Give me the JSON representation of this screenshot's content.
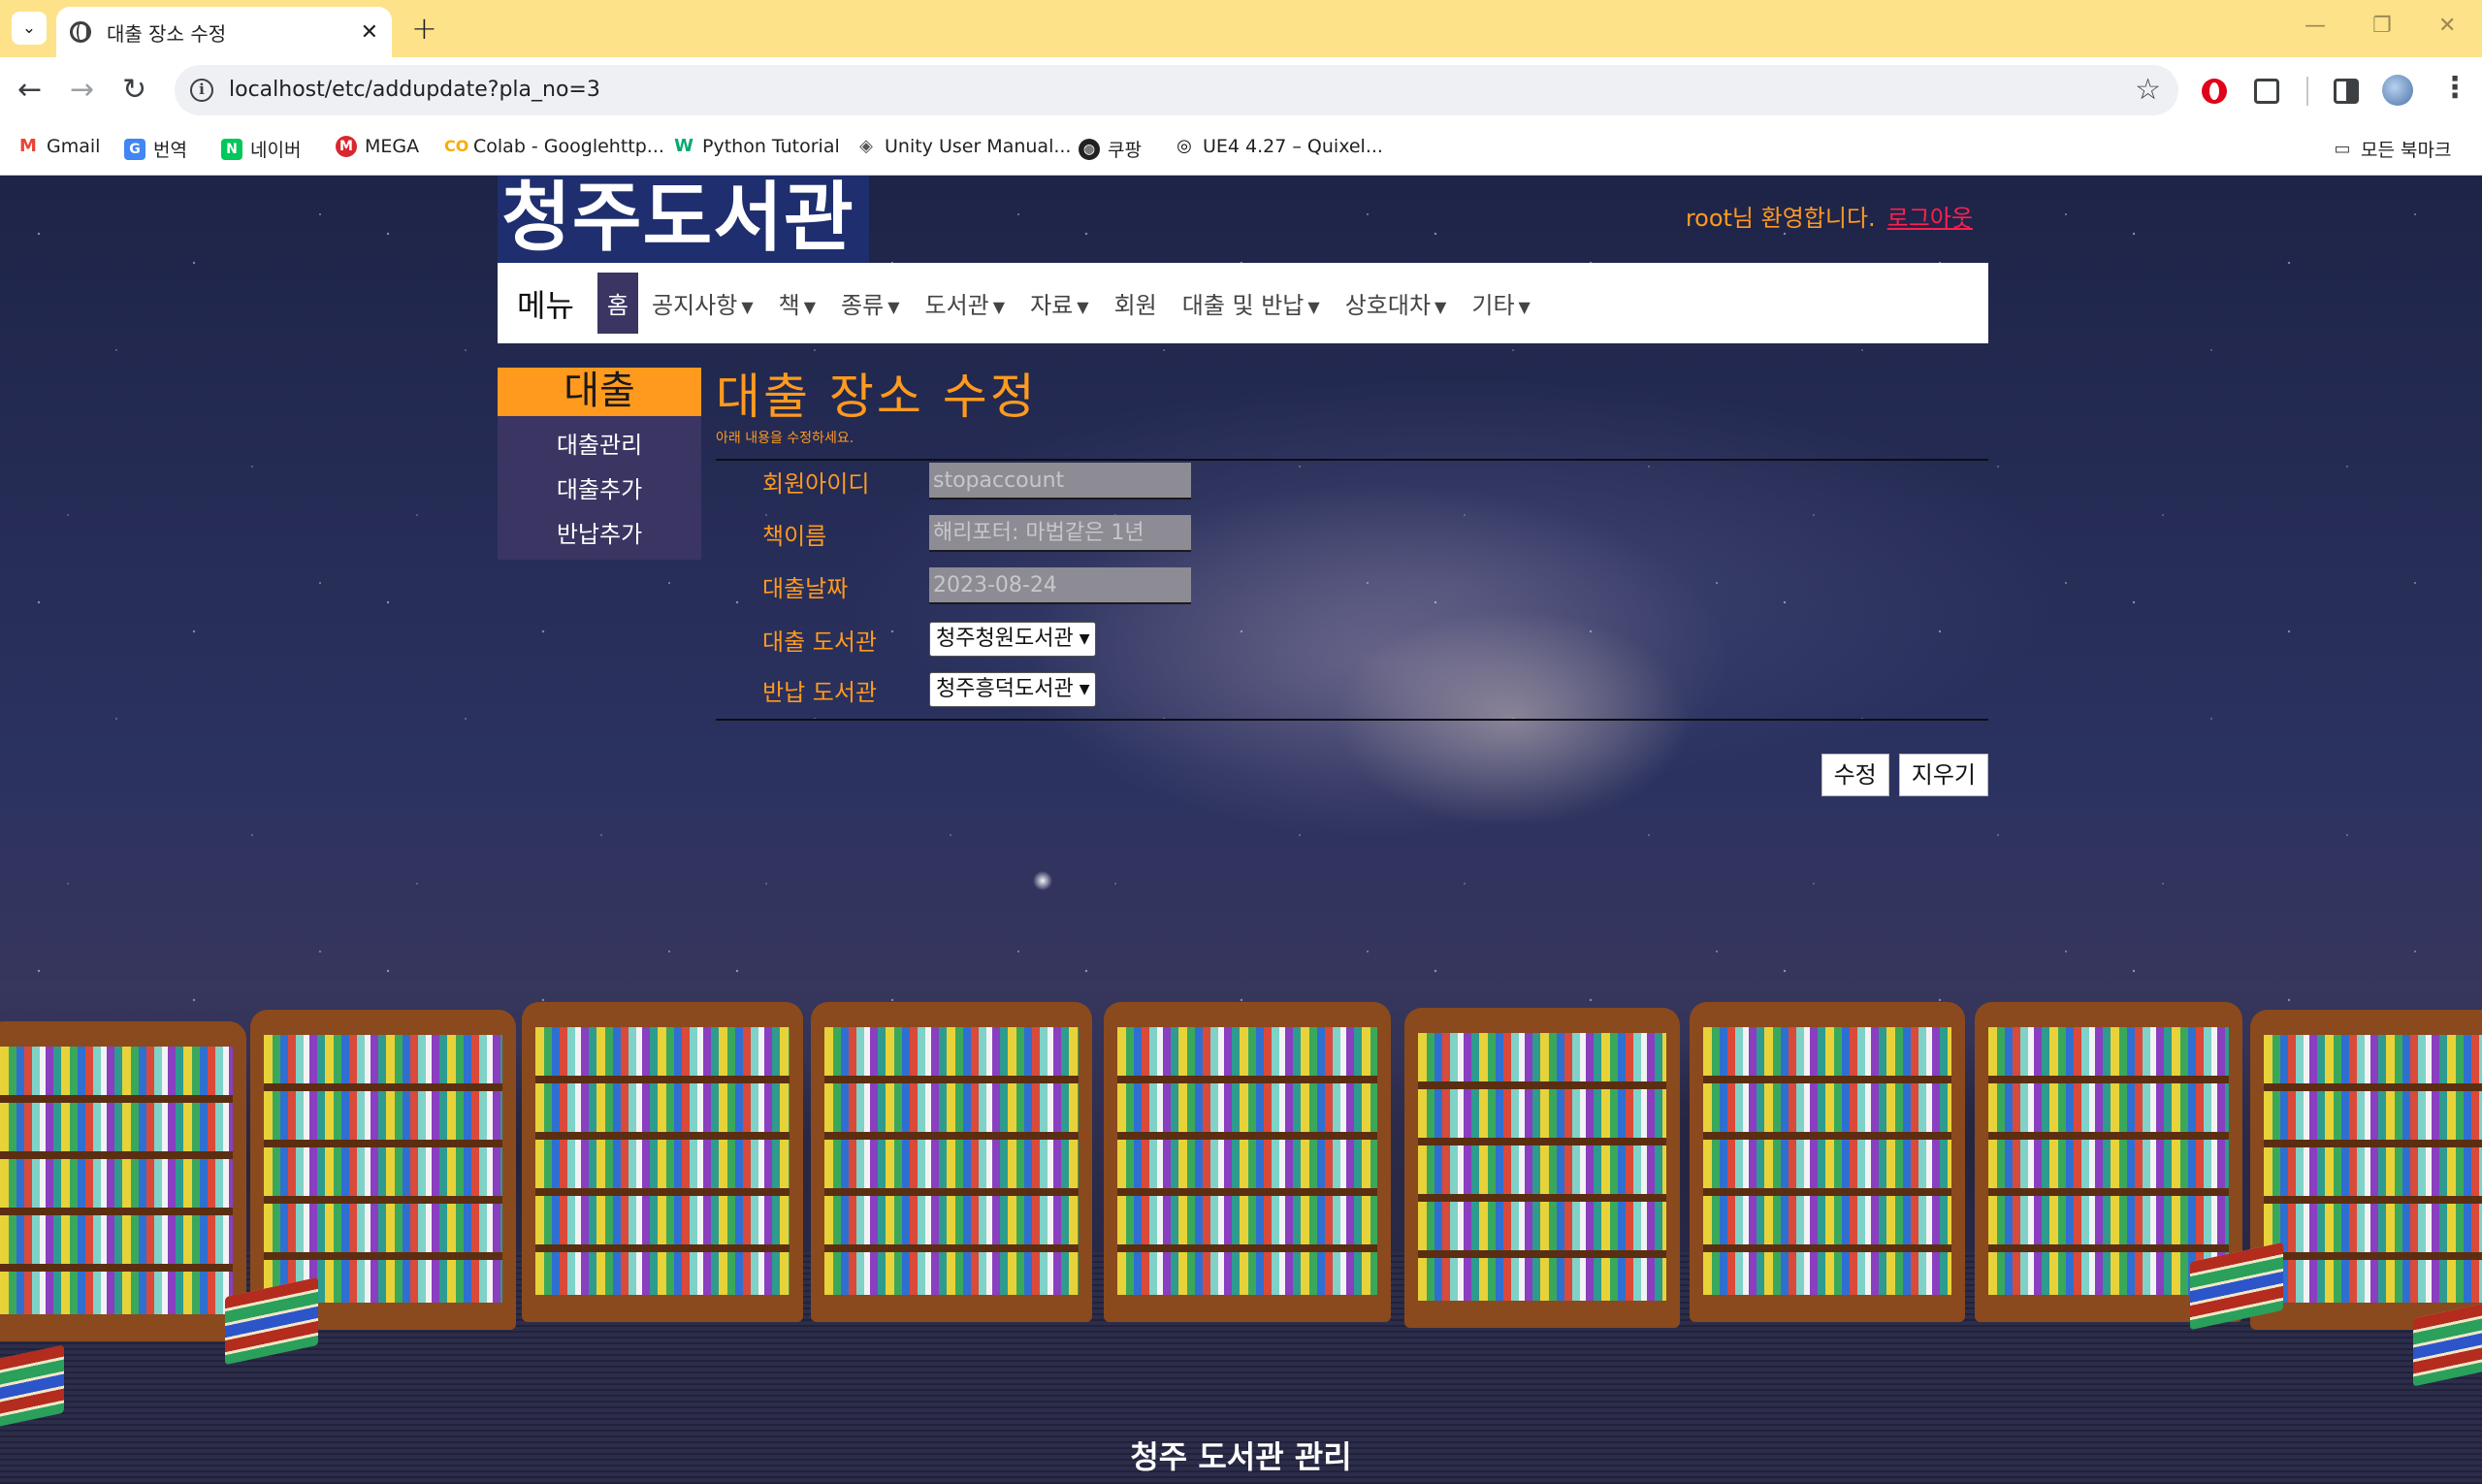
{
  "browser": {
    "tab_title": "대출 장소 수정",
    "url": "localhost/etc/addupdate?pla_no=3",
    "bookmarks": [
      {
        "label": "Gmail",
        "icon": "gmail-icon",
        "color": "#ea4335"
      },
      {
        "label": "번역",
        "icon": "translate-icon",
        "color": "#4285f4"
      },
      {
        "label": "네이버",
        "icon": "naver-icon",
        "color": "#03c75a"
      },
      {
        "label": "MEGA",
        "icon": "mega-icon",
        "color": "#d9272e"
      },
      {
        "label": "Colab - Googlehttp...",
        "icon": "colab-icon",
        "color": "#f9ab00"
      },
      {
        "label": "Python Tutorial",
        "icon": "w3schools-icon",
        "color": "#04aa6d"
      },
      {
        "label": "Unity User Manual...",
        "icon": "unity-icon",
        "color": "#555555"
      },
      {
        "label": "쿠팡",
        "icon": "globe-icon",
        "color": "#222222"
      },
      {
        "label": "UE4 4.27 – Quixel...",
        "icon": "quixel-icon",
        "color": "#111111"
      }
    ],
    "all_bookmarks": "모든 북마크"
  },
  "site": {
    "logo": "청주도서관",
    "welcome": "root님 환영합니다.",
    "logout": "로그아웃",
    "nav": {
      "brand": "메뉴",
      "items": [
        "홈",
        "공지사항",
        "책",
        "종류",
        "도서관",
        "자료",
        "회원",
        "대출 및 반납",
        "상호대차",
        "기타"
      ]
    },
    "sidebar": {
      "title": "대출",
      "items": [
        "대출관리",
        "대출추가",
        "반납추가"
      ]
    },
    "page": {
      "title": "대출 장소 수정",
      "subtitle": "아래 내용을 수정하세요."
    },
    "form": {
      "member_id_label": "회원아이디",
      "member_id_value": "stopaccount",
      "book_name_label": "책이름",
      "book_name_value": "해리포터: 마법같은 1년",
      "loan_date_label": "대출날짜",
      "loan_date_value": "2023-08-24",
      "loan_library_label": "대출 도서관",
      "loan_library_value": "청주청원도서관",
      "return_library_label": "반납 도서관",
      "return_library_value": "청주흥덕도서관"
    },
    "buttons": {
      "submit": "수정",
      "clear": "지우기"
    },
    "footer": "청주 도서관 관리"
  },
  "colors": {
    "accent": "#ff9a1f",
    "nav_active": "#3a3563",
    "logo_bg": "#1f2e6e",
    "logout": "#ff2050"
  }
}
